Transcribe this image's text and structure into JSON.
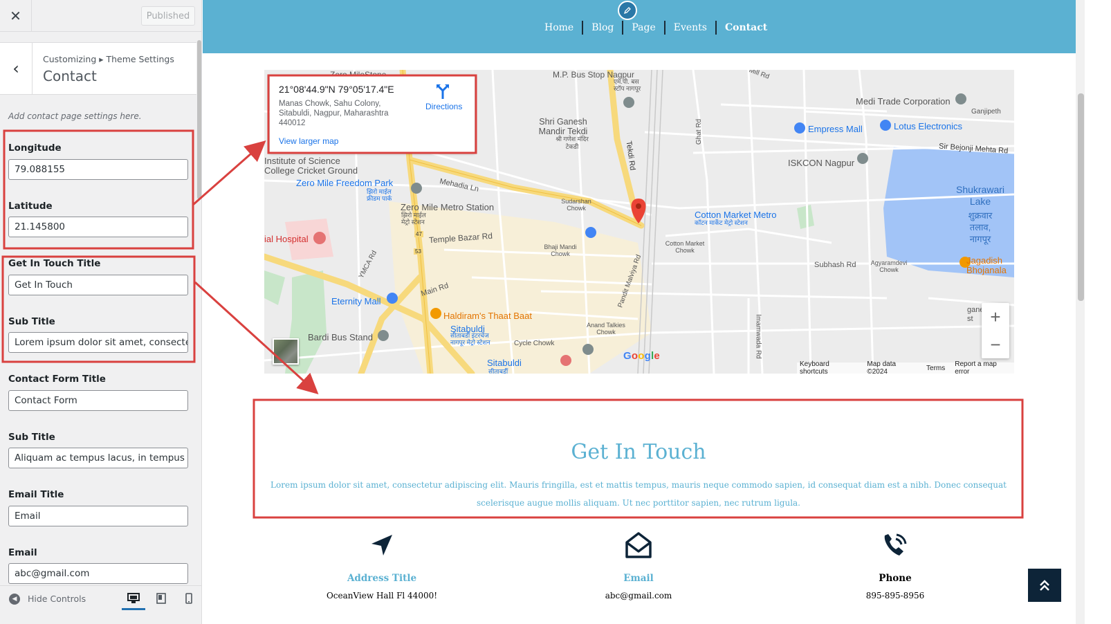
{
  "sidebar": {
    "close_icon": "close-icon",
    "published_label": "Published",
    "breadcrumb": "Customizing ▸ Theme Settings",
    "title": "Contact",
    "description": "Add contact page settings here.",
    "fields": [
      {
        "label": "Longitude",
        "value": "79.088155"
      },
      {
        "label": "Latitude",
        "value": "21.145800"
      },
      {
        "label": "Get In Touch Title",
        "value": "Get In Touch"
      },
      {
        "label": "Sub Title",
        "value": "Lorem ipsum dolor sit amet, consectetur"
      },
      {
        "label": "Contact Form Title",
        "value": "Contact Form"
      },
      {
        "label": "Sub Title",
        "value": "Aliquam ac tempus lacus, in tempus nisi"
      },
      {
        "label": "Email Title",
        "value": "Email"
      },
      {
        "label": "Email",
        "value": "abc@gmail.com"
      }
    ],
    "hide_controls": "Hide Controls"
  },
  "preview": {
    "nav": [
      "Home",
      "Blog",
      "Page",
      "Events",
      "Contact"
    ],
    "active_nav": "Contact",
    "map": {
      "card": {
        "coords": "21°08'44.9\"N 79°05'17.4\"E",
        "address": "Manas Chowk, Sahu Colony, Sitabuldi, Nagpur, Maharashtra 440012",
        "directions": "Directions",
        "view_larger": "View larger map"
      },
      "labels": {
        "zero_milestone": "Zero MileStone",
        "mp_bus_stop": "M.P. Bus Stop Nagpur",
        "mp_bus_stop_hi": "एम.पी. बस स्टॉप नागपूर",
        "mill_rd": "Mill Rd",
        "medi_trade": "Medi Trade Corporation",
        "ganjipeth": "Ganjipeth",
        "shri_ganesh": "Shri Ganesh Mandir Tekdi",
        "shri_ganesh_hi": "श्री गणेश मंदिर टेकडी",
        "empress_mall": "Empress Mall",
        "lotus": "Lotus Electronics",
        "bejonji": "Sir Bejonji Mehta Rd",
        "iskcon": "ISKCON Nagpur",
        "science_college": "Institute of Science College Cricket Ground",
        "zero_mile_park": "Zero Mile Freedom Park",
        "zero_mile_park_hi": "झिरो माईल फ्रीडम पार्क",
        "mehadia": "Mehadia Ln",
        "sudarshan": "Sudarshan Chowk",
        "zero_mile_metro": "Zero Mile Metro Station",
        "zero_mile_metro_hi": "झिरो माईल मेट्रो स्टेशन",
        "cotton_market_metro": "Cotton Market Metro",
        "cotton_market_metro_hi": "कॉटन मार्केट मेट्रो स्टेशन",
        "shukrawari": "Shukrawari Lake",
        "shukrawari_hi": "शुक्रवार तलाव, नागपूर",
        "hospital": "ial Hospital",
        "temple_bazar": "Temple Bazar Rd",
        "bhaji_mandi": "Bhaji Mandi Chowk",
        "cotton_market": "Cotton Market Chowk",
        "subhash": "Subhash Rd",
        "agyaramdevi": "Agyaramdevi Chowk",
        "jagdish": "Jagadish Bhojanala",
        "ymca": "YMCA Rd",
        "main_rd": "Main Rd",
        "pandit": "Pandit Malviya Rd",
        "eternity": "Eternity Mall",
        "haldiram": "Haldiram's Thaat Baat",
        "sitabuldi_interchange": "Sitabuldi",
        "sitabuldi_interchange_hi": "सीताबर्डी इंटरचेंज नागपूर मेट्रो स्टेशन",
        "anand_talkies": "Anand Talkies Chowk",
        "bardi_bus": "Bardi Bus Stand",
        "cycle_chowk": "Cycle Chowk",
        "sitabuldi_metro": "Sitabuldi",
        "sitabuldi_metro_hi": "सीताबर्डी",
        "ghat_rd": "Ghat Rd",
        "tekdi_rd": "Tekdi Rd",
        "imamwada": "Imamwada Rd",
        "ganesh_st": "gane st",
        "hwy_47": "47",
        "hwy_53": "53"
      },
      "zoom_in": "+",
      "zoom_out": "−",
      "google": "Google",
      "footer": [
        "Keyboard shortcuts",
        "Map data ©2024",
        "Terms",
        "Report a map error"
      ]
    },
    "get_in_touch": {
      "title": "Get In Touch",
      "subtitle": "Lorem ipsum dolor sit amet, consectetur adipiscing elit. Mauris fringilla, est et mattis tempus, mauris neque commodo sapien, id consequat diam est a nibh. Donec consequat scelerisque augue mollis aliquam. Ut nec porttitor sapien, nec rutrum ligula."
    },
    "info": [
      {
        "icon": "location-arrow-icon",
        "title": "Address Title",
        "value": "OceanView Hall Fl 44000!"
      },
      {
        "icon": "envelope-open-icon",
        "title": "Email",
        "value": "abc@gmail.com"
      },
      {
        "icon": "phone-volume-icon",
        "title": "Phone",
        "value": "895-895-8956"
      }
    ]
  },
  "colors": {
    "header_bg": "#5bb1d2",
    "accent": "#5bb1d2",
    "annotation": "#d9413f",
    "dark": "#0d2438"
  }
}
